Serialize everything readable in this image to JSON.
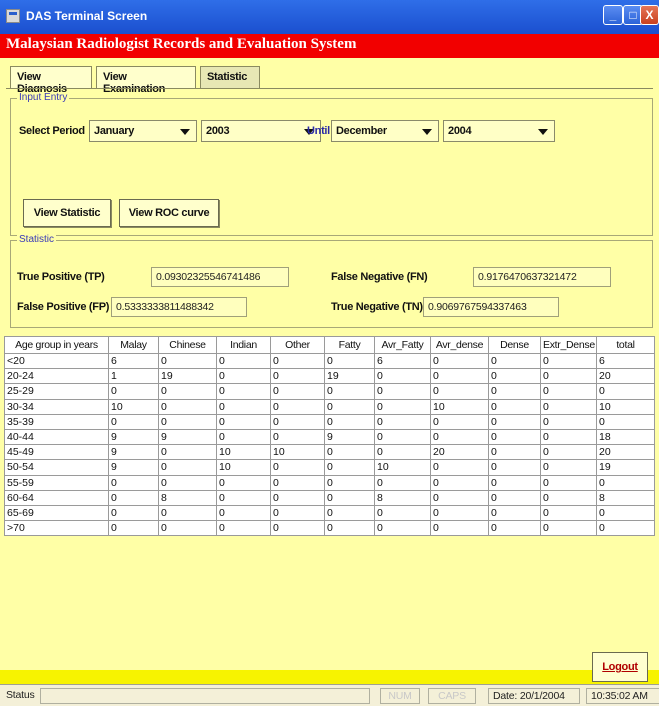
{
  "window": {
    "title": "DAS Terminal Screen",
    "buttons": {
      "minimize": "_",
      "maximize": "□",
      "close": "X"
    }
  },
  "banner": "Malaysian Radiologist Records and Evaluation System",
  "tabs": [
    "View Diagnosis",
    "View Examination",
    "Statistic"
  ],
  "input_entry": {
    "legend": "Input Entry",
    "select_period_label": "Select Period",
    "from_month": "January",
    "from_year": "2003",
    "until_label": "Until",
    "to_month": "December",
    "to_year": "2004",
    "view_statistic_button": "View Statistic",
    "view_roc_button": "View ROC curve"
  },
  "statistic": {
    "legend": "Statistic",
    "tp_label": "True Positive (TP)",
    "tp_value": "0.09302325546741486",
    "fn_label": "False Negative (FN)",
    "fn_value": "0.9176470637321472",
    "fp_label": "False Positive (FP)",
    "fp_value": "0.5333333811488342",
    "tn_label": "True Negative (TN)",
    "tn_value": "0.9069767594337463"
  },
  "table": {
    "headers": [
      "Age group in years",
      "Malay",
      "Chinese",
      "Indian",
      "Other",
      "Fatty",
      "Avr_Fatty",
      "Avr_dense",
      "Dense",
      "Extr_Dense",
      "total"
    ],
    "rows": [
      [
        "<20",
        "6",
        "0",
        "0",
        "0",
        "0",
        "6",
        "0",
        "0",
        "0",
        "6"
      ],
      [
        "20-24",
        "1",
        "19",
        "0",
        "0",
        "19",
        "0",
        "0",
        "0",
        "0",
        "20"
      ],
      [
        "25-29",
        "0",
        "0",
        "0",
        "0",
        "0",
        "0",
        "0",
        "0",
        "0",
        "0"
      ],
      [
        "30-34",
        "10",
        "0",
        "0",
        "0",
        "0",
        "0",
        "10",
        "0",
        "0",
        "10"
      ],
      [
        "35-39",
        "0",
        "0",
        "0",
        "0",
        "0",
        "0",
        "0",
        "0",
        "0",
        "0"
      ],
      [
        "40-44",
        "9",
        "9",
        "0",
        "0",
        "9",
        "0",
        "0",
        "0",
        "0",
        "18"
      ],
      [
        "45-49",
        "9",
        "0",
        "10",
        "10",
        "0",
        "0",
        "20",
        "0",
        "0",
        "20"
      ],
      [
        "50-54",
        "9",
        "0",
        "10",
        "0",
        "0",
        "10",
        "0",
        "0",
        "0",
        "19"
      ],
      [
        "55-59",
        "0",
        "0",
        "0",
        "0",
        "0",
        "0",
        "0",
        "0",
        "0",
        "0"
      ],
      [
        "60-64",
        "0",
        "8",
        "0",
        "0",
        "0",
        "8",
        "0",
        "0",
        "0",
        "8"
      ],
      [
        "65-69",
        "0",
        "0",
        "0",
        "0",
        "0",
        "0",
        "0",
        "0",
        "0",
        "0"
      ],
      [
        ">70",
        "0",
        "0",
        "0",
        "0",
        "0",
        "0",
        "0",
        "0",
        "0",
        "0"
      ]
    ]
  },
  "logout_button": "Logout",
  "statusbar": {
    "status_label": "Status",
    "num": "NUM",
    "caps": "CAPS",
    "date": "Date: 20/1/2004",
    "time": "10:35:02 AM"
  },
  "colors": {
    "title_bar": "#1b4fcf",
    "banner": "#f20000",
    "panel": "#ffffa6",
    "bottom_bar": "#f7f300"
  }
}
